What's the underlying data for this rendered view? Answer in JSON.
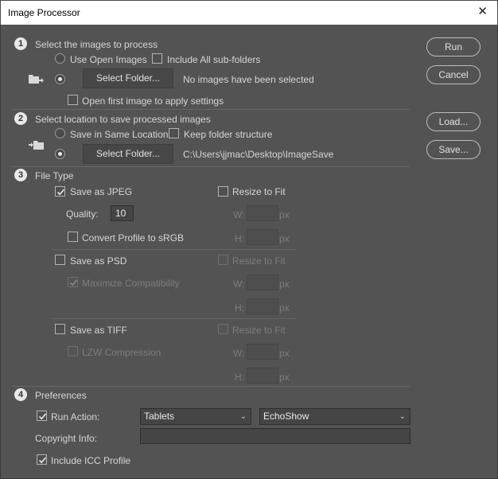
{
  "window": {
    "title": "Image Processor",
    "close_glyph": "✕"
  },
  "section1": {
    "number": "1",
    "title": "Select the images to process",
    "use_open_images_label": "Use Open Images",
    "use_open_images_selected": false,
    "include_subfolders_label": "Include All sub-folders",
    "include_subfolders_checked": false,
    "select_folder_selected": true,
    "select_folder_button": "Select Folder...",
    "folder_status": "No images have been selected",
    "open_first_label": "Open first image to apply settings",
    "open_first_checked": false,
    "icon": "folder-import-icon"
  },
  "section2": {
    "number": "2",
    "title": "Select location to save processed images",
    "same_location_label": "Save in Same Location",
    "same_location_selected": false,
    "keep_structure_label": "Keep folder structure",
    "keep_structure_checked": false,
    "select_folder_selected": true,
    "select_folder_button": "Select Folder...",
    "folder_path": "C:\\Users\\jjmac\\Desktop\\ImageSave",
    "icon": "folder-export-icon"
  },
  "section3": {
    "number": "3",
    "title": "File Type",
    "jpeg": {
      "label": "Save as JPEG",
      "checked": true,
      "quality_label": "Quality:",
      "quality_value": "10",
      "convert_label": "Convert Profile to sRGB",
      "convert_checked": false,
      "resize_label": "Resize to Fit",
      "resize_checked": false,
      "w_label": "W:",
      "h_label": "H:",
      "w_value": "",
      "h_value": "",
      "unit": "px"
    },
    "psd": {
      "label": "Save as PSD",
      "checked": false,
      "maximize_label": "Maximize Compatibility",
      "maximize_checked": true,
      "resize_label": "Resize to Fit",
      "resize_checked": false,
      "w_label": "W:",
      "h_label": "H:",
      "w_value": "",
      "h_value": "",
      "unit": "px"
    },
    "tiff": {
      "label": "Save as TIFF",
      "checked": false,
      "lzw_label": "LZW Compression",
      "lzw_checked": false,
      "resize_label": "Resize to Fit",
      "resize_checked": false,
      "w_label": "W:",
      "h_label": "H:",
      "w_value": "",
      "h_value": "",
      "unit": "px"
    }
  },
  "section4": {
    "number": "4",
    "title": "Preferences",
    "run_action_label": "Run Action:",
    "run_action_checked": true,
    "action_set": "Tablets",
    "action_name": "EchoShow",
    "copyright_label": "Copyright Info:",
    "copyright_value": "",
    "icc_label": "Include ICC Profile",
    "icc_checked": true
  },
  "buttons": {
    "run": "Run",
    "cancel": "Cancel",
    "load": "Load...",
    "save": "Save..."
  },
  "colors": {
    "dialog_bg": "#535353",
    "titlebar_bg": "#ffffff",
    "text": "#d6d6d6",
    "disabled_text": "#7d7d7d"
  }
}
